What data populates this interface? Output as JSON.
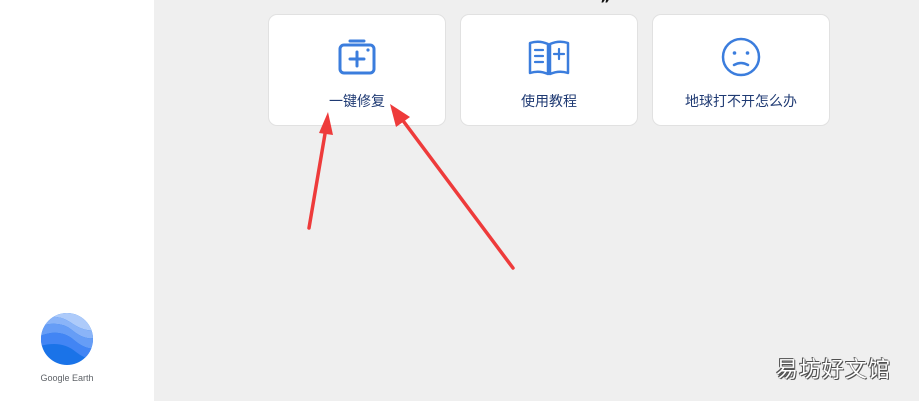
{
  "app": {
    "logo_label": "Google Earth"
  },
  "top_glyph": "”",
  "cards": [
    {
      "label": "一键修复",
      "icon": "first-aid-kit-icon"
    },
    {
      "label": "使用教程",
      "icon": "open-book-icon"
    },
    {
      "label": "地球打不开怎么办",
      "icon": "sad-face-icon"
    }
  ],
  "watermark": "易坊好文馆",
  "colors": {
    "accent": "#3b7ddd",
    "label": "#1f3a73",
    "annotation": "#ee3b3b"
  }
}
